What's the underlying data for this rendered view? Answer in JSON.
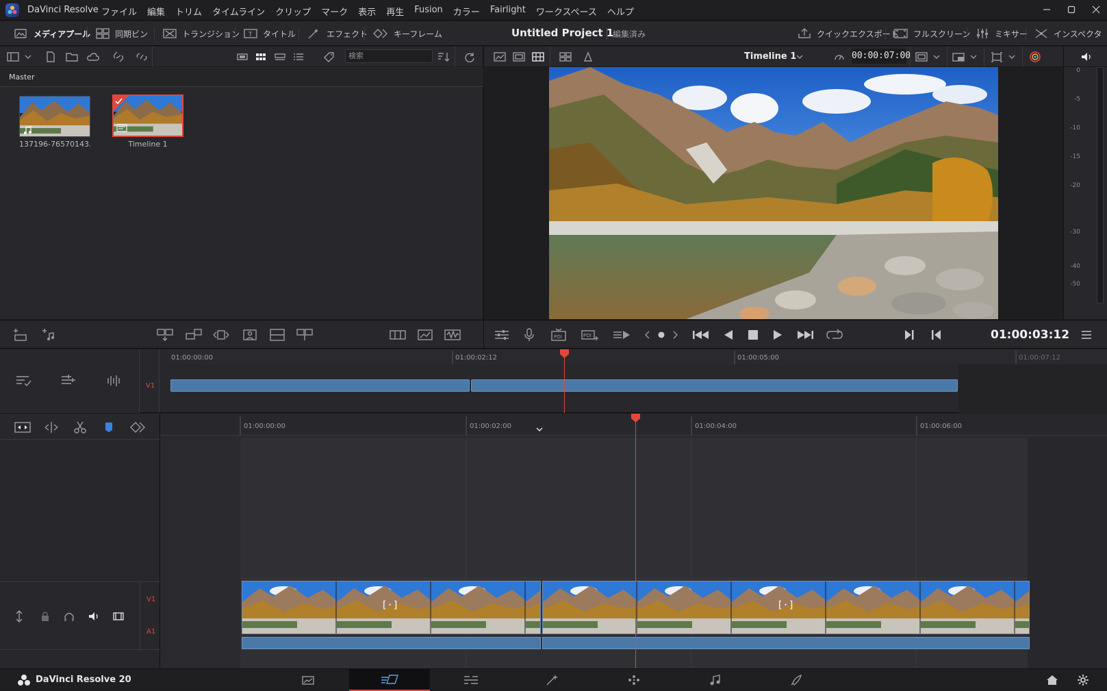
{
  "titlebar": {
    "app_title": "DaVinci Resolve",
    "menu": [
      "ファイル",
      "編集",
      "トリム",
      "タイムライン",
      "クリップ",
      "マーク",
      "表示",
      "再生",
      "Fusion",
      "カラー",
      "Fairlight",
      "ワークスペース",
      "ヘルプ"
    ]
  },
  "toolbar": {
    "media_pool": "メディアプール",
    "sync_bin": "同期ビン",
    "transitions": "トランジション",
    "titles": "タイトル",
    "effects": "エフェクト",
    "keyframes": "キーフレーム",
    "project_title": "Untitled Project 1",
    "project_status": "編集済み",
    "quick_export": "クイックエクスポート",
    "fullscreen": "フルスクリーン",
    "mixer": "ミキサー",
    "inspector": "インスペクタ"
  },
  "media_pool": {
    "bin_name": "Master",
    "search_placeholder": "検索",
    "clips": [
      {
        "name": "137196-76570143..."
      },
      {
        "name": "Timeline 1",
        "selected": true
      }
    ]
  },
  "viewer": {
    "timeline_name": "Timeline 1",
    "duration_timecode": "00:00:07:00",
    "current_timecode": "01:00:03:12"
  },
  "audio_meter": {
    "scale": [
      "0",
      "-5",
      "-10",
      "-15",
      "-20",
      "-30",
      "-40",
      "-50"
    ]
  },
  "upper_timeline": {
    "track": "V1",
    "ruler": [
      "01:00:00:00",
      "01:00:02:12",
      "01:00:05:00",
      "01:00:07:12"
    ]
  },
  "lower_timeline": {
    "tracks": [
      "V1",
      "A1"
    ],
    "ruler": [
      "01:00:00:00",
      "01:00:02:00",
      "01:00:04:00",
      "01:00:06:00"
    ]
  },
  "bottom_bar": {
    "brand": "DaVinci Resolve 20",
    "pages": [
      "media",
      "cut",
      "edit",
      "fusion",
      "color",
      "fairlight",
      "deliver"
    ],
    "active_page": "cut"
  },
  "colors": {
    "accent_red": "#e4463c",
    "clip_blue": "#4a79a8",
    "background": "#28282c"
  }
}
